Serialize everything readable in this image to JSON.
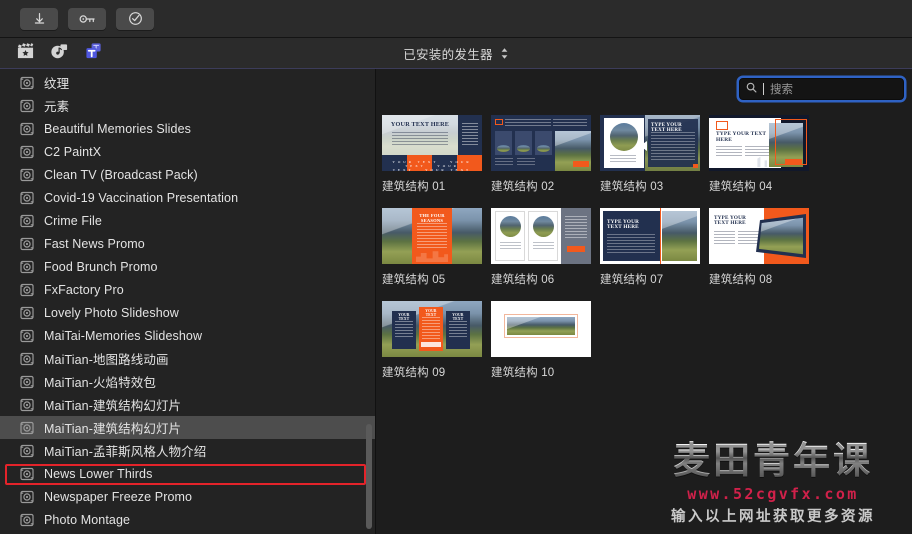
{
  "toolbar": {
    "buttons": [
      {
        "name": "download-button",
        "icon": "download-icon"
      },
      {
        "name": "keyframe-button",
        "icon": "key-icon"
      },
      {
        "name": "apply-button",
        "icon": "check-circle-icon"
      }
    ]
  },
  "tabbar": {
    "tabs": [
      {
        "name": "tab-video-effects",
        "icon": "clapperboard-star-icon",
        "active": false
      },
      {
        "name": "tab-audio-effects",
        "icon": "music-photo-icon",
        "active": false
      },
      {
        "name": "tab-titles-generators",
        "icon": "blue-t-icon",
        "active": true
      }
    ],
    "title": "已安装的发生器",
    "stepper_icon": "chevron-up-down-icon"
  },
  "search": {
    "placeholder": "搜索",
    "value": "",
    "icon": "search-icon",
    "focus_color": "#2f62c4"
  },
  "sidebar": {
    "scrollbar_visible": true,
    "selected_index": 15,
    "annotation_color": "#e4232a",
    "items": [
      {
        "label": "纹理"
      },
      {
        "label": "元素"
      },
      {
        "label": "Beautiful Memories Slides"
      },
      {
        "label": "C2 PaintX"
      },
      {
        "label": "Clean TV (Broadcast Pack)"
      },
      {
        "label": "Covid-19 Vaccination Presentation"
      },
      {
        "label": "Crime File"
      },
      {
        "label": "Fast News Promo"
      },
      {
        "label": "Food Brunch Promo"
      },
      {
        "label": "FxFactory Pro"
      },
      {
        "label": "Lovely Photo Slideshow"
      },
      {
        "label": "MaiTai-Memories Slideshow"
      },
      {
        "label": "MaiTian-地图路线动画"
      },
      {
        "label": "MaiTian-火焰特效包"
      },
      {
        "label": "MaiTian-建筑结构幻灯片"
      },
      {
        "label": "MaiTian-建筑结构幻灯片"
      },
      {
        "label": "MaiTian-孟菲斯风格人物介绍"
      },
      {
        "label": "News Lower Thirds"
      },
      {
        "label": "Newspaper Freeze Promo"
      },
      {
        "label": "Photo Montage"
      }
    ]
  },
  "grid": {
    "items": [
      {
        "label": "建筑结构 01",
        "style": "s01",
        "text": "YOUR TEXT HERE"
      },
      {
        "label": "建筑结构 02",
        "style": "s02",
        "text": ""
      },
      {
        "label": "建筑结构 03",
        "style": "s03",
        "text": "TYPE YOUR TEXT HERE"
      },
      {
        "label": "建筑结构 04",
        "style": "s04",
        "text": "TYPE YOUR TEXT HERE"
      },
      {
        "label": "建筑结构 05",
        "style": "s05",
        "text": "THE FOUR SEASONS"
      },
      {
        "label": "建筑结构 06",
        "style": "s06",
        "text": ""
      },
      {
        "label": "建筑结构 07",
        "style": "s07",
        "text": "TYPE YOUR TEXT HERE"
      },
      {
        "label": "建筑结构 08",
        "style": "s08",
        "text": "TYPE YOUR TEXT HERE"
      },
      {
        "label": "建筑结构 09",
        "style": "s09",
        "text": "YOUR TEXT"
      },
      {
        "label": "建筑结构 10",
        "style": "s10",
        "text": ""
      }
    ]
  },
  "watermark": {
    "line1": "麦田青年课",
    "line2": "www.52cgvfx.com",
    "line3": "输入以上网址获取更多资源"
  }
}
